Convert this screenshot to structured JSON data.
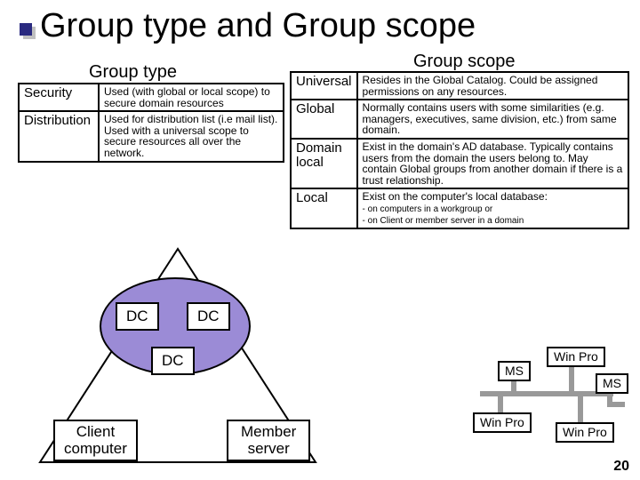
{
  "title": "Group type and Group scope",
  "groupTypeHeading": "Group type",
  "groupScopeHeading": "Group scope",
  "typeTable": {
    "rows": [
      {
        "name": "Security",
        "desc": "Used (with global or local scope) to secure domain resources"
      },
      {
        "name": "Distribution",
        "desc": "Used for distribution list (i.e mail list). Used with a universal scope to secure resources all over the network."
      }
    ]
  },
  "scopeTable": {
    "rows": [
      {
        "name": "Universal",
        "desc": "Resides in the Global Catalog. Could be assigned permissions on any resources."
      },
      {
        "name": "Global",
        "desc": "Normally contains users with some similarities (e.g. managers, executives, same division, etc.) from same domain."
      },
      {
        "name": "Domain local",
        "desc": "Exist in the domain's AD database. Typically contains users from the domain the users belong to. May contain Global groups from another domain if there is a trust relationship."
      },
      {
        "name": "Local",
        "desc": "Exist on the computer's local database:",
        "sub": "- on computers in a workgroup or\n- on Client or member server in a domain"
      }
    ]
  },
  "diagram": {
    "dc": "DC",
    "client": "Client\ncomputer",
    "member": "Member\nserver"
  },
  "net": {
    "ms": "MS",
    "winpro": "Win Pro"
  },
  "pageNumber": "20"
}
